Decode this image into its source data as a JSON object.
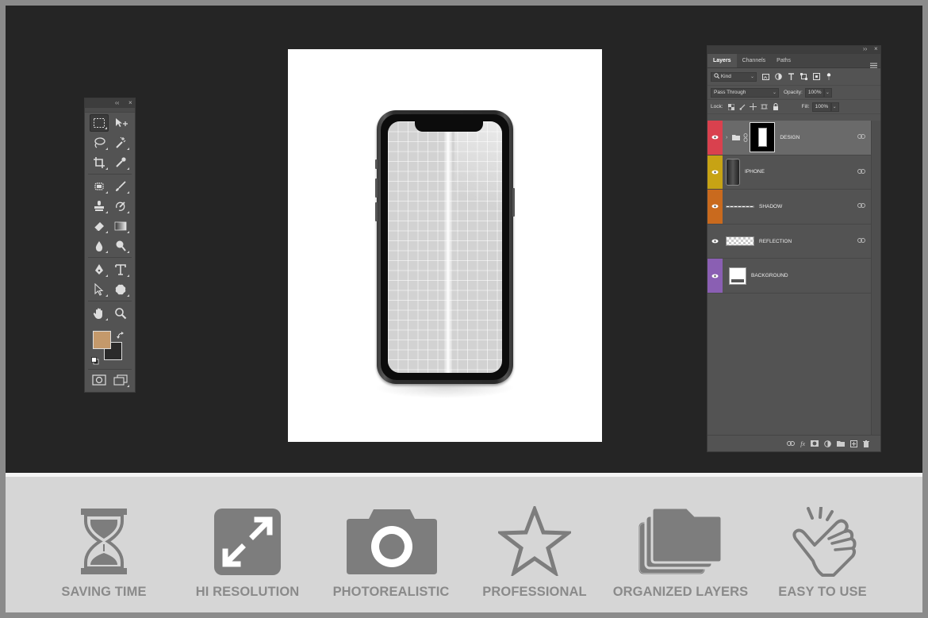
{
  "panels": {
    "tools": {
      "collapse_glyph": "‹‹",
      "close_glyph": "×",
      "foreground_color": "#c4996b",
      "background_color": "#2a2a2a"
    },
    "layers": {
      "collapse_glyph": "››",
      "close_glyph": "×",
      "tabs": [
        {
          "label": "Layers",
          "active": true
        },
        {
          "label": "Channels",
          "active": false
        },
        {
          "label": "Paths",
          "active": false
        }
      ],
      "filter": {
        "kind_label": "Kind"
      },
      "blend_mode": "Pass Through",
      "opacity_label": "Opacity:",
      "opacity_value": "100%",
      "lock_label": "Lock:",
      "fill_label": "Fill:",
      "fill_value": "100%",
      "layers": [
        {
          "name": "DESIGN",
          "tag_color": "#d9414e",
          "active": true
        },
        {
          "name": "IPHONE",
          "tag_color": "#c7a314",
          "active": false
        },
        {
          "name": "SHADOW",
          "tag_color": "#c96a1e",
          "active": false
        },
        {
          "name": "REFLECTION",
          "tag_color": "",
          "active": false
        },
        {
          "name": "BACKGROUND",
          "tag_color": "#8a5fb3",
          "active": false
        }
      ],
      "footer_fx": "fx"
    }
  },
  "features": [
    {
      "label": "SAVING TIME",
      "icon": "hourglass-icon"
    },
    {
      "label": "HI RESOLUTION",
      "icon": "expand-arrows-icon"
    },
    {
      "label": "PHOTOREALISTIC",
      "icon": "camera-icon"
    },
    {
      "label": "PROFESSIONAL",
      "icon": "star-icon"
    },
    {
      "label": "ORGANIZED LAYERS",
      "icon": "folder-stack-icon"
    },
    {
      "label": "EASY TO USE",
      "icon": "tap-hand-icon"
    }
  ],
  "colors": {
    "workspace": "#252525",
    "panel": "#535353",
    "feature_gray": "#7d7d7d",
    "feature_bg": "#d6d6d6"
  }
}
